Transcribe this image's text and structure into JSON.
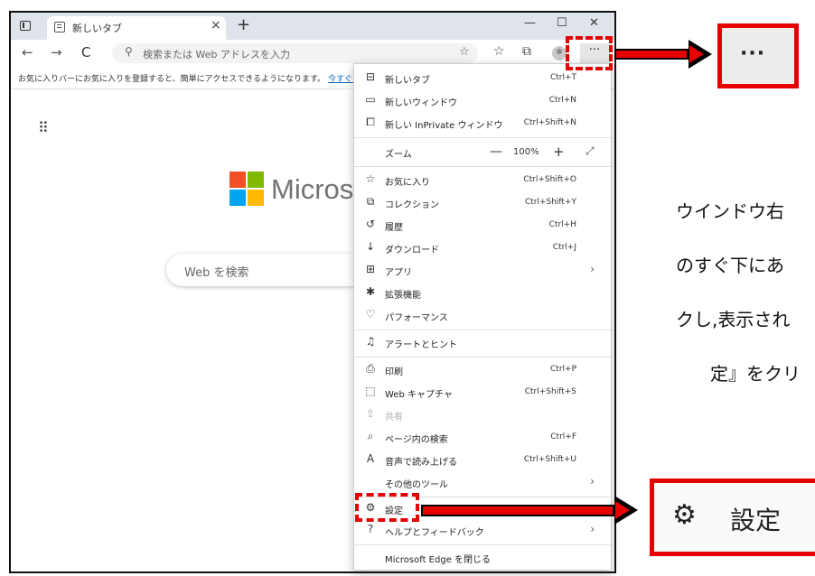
{
  "tab": {
    "title": "新しいタブ",
    "close": "×",
    "new_tab": "+"
  },
  "window_controls": {
    "minimize": "—",
    "maximize": "☐",
    "close": "✕"
  },
  "toolbar": {
    "back": "←",
    "forward": "→",
    "refresh": "C",
    "address_placeholder": "検索または Web アドレスを入力",
    "more": "···"
  },
  "favorites_bar": {
    "message": "お気に入りバーにお気に入りを登録すると、簡単にアクセスできるようになります。",
    "link": "今すぐお気に入"
  },
  "new_tab_page": {
    "brand": "Micros",
    "search_placeholder": "Web を検索",
    "logo_colors": [
      "#f25022",
      "#7fba00",
      "#00a4ef",
      "#ffb900"
    ]
  },
  "menu": {
    "new_tab": {
      "label": "新しいタブ",
      "shortcut": "Ctrl+T"
    },
    "new_window": {
      "label": "新しいウィンドウ",
      "shortcut": "Ctrl+N"
    },
    "new_inprivate": {
      "label": "新しい InPrivate ウィンドウ",
      "shortcut": "Ctrl+Shift+N"
    },
    "zoom": {
      "label": "ズーム",
      "minus": "—",
      "value": "100%",
      "plus": "+"
    },
    "favorites": {
      "label": "お気に入り",
      "shortcut": "Ctrl+Shift+O"
    },
    "collections": {
      "label": "コレクション",
      "shortcut": "Ctrl+Shift+Y"
    },
    "history": {
      "label": "履歴",
      "shortcut": "Ctrl+H"
    },
    "downloads": {
      "label": "ダウンロード",
      "shortcut": "Ctrl+J"
    },
    "apps": {
      "label": "アプリ"
    },
    "extensions": {
      "label": "拡張機能"
    },
    "performance": {
      "label": "パフォーマンス"
    },
    "alerts": {
      "label": "アラートとヒント"
    },
    "print": {
      "label": "印刷",
      "shortcut": "Ctrl+P"
    },
    "web_capture": {
      "label": "Web キャプチャ",
      "shortcut": "Ctrl+Shift+S"
    },
    "share": {
      "label": "共有"
    },
    "find": {
      "label": "ページ内の検索",
      "shortcut": "Ctrl+F"
    },
    "read_aloud": {
      "label": "音声で読み上げる",
      "shortcut": "Ctrl+Shift+U"
    },
    "more_tools": {
      "label": "その他のツール"
    },
    "settings": {
      "label": "設定"
    },
    "help": {
      "label": "ヘルプとフィードバック"
    },
    "close_edge": {
      "label": "Microsoft Edge を閉じる"
    }
  },
  "annotation": {
    "instruction_lines": [
      "ウインドウ右",
      "のすぐ下にあ",
      "クし,表示され",
      "定』をクリ"
    ],
    "zoom_more": "···",
    "zoom_settings_label": "設定",
    "accent_color": "#e60000"
  }
}
